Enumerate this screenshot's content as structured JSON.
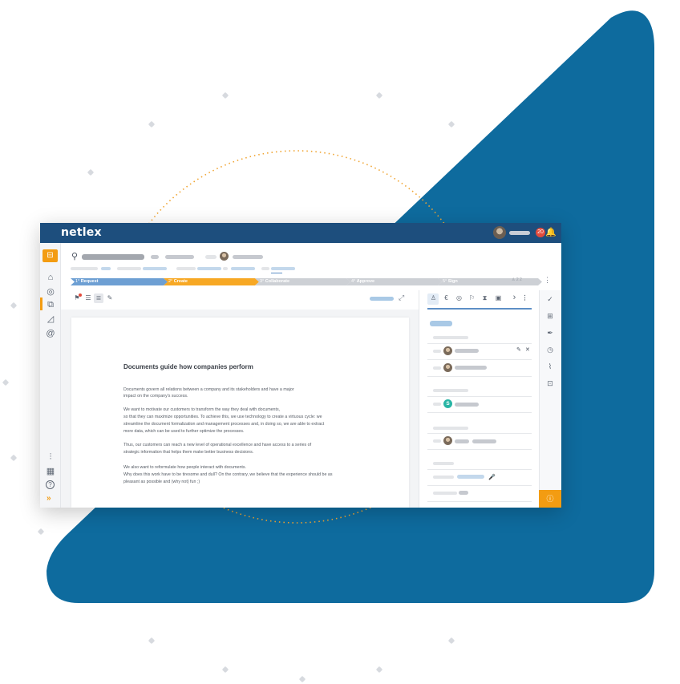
{
  "app": {
    "logo": "netlex",
    "notification_count": "20"
  },
  "icons": {
    "app_switch": "⊟",
    "home": "⌂",
    "chat": "◎",
    "documents": "⧉",
    "signature": "◿",
    "at": "@",
    "filters": "⫶",
    "calendar": "▦",
    "help": "?",
    "expand": "»",
    "bell": "🔔",
    "stamp": "⚲",
    "more": "⋮",
    "fullscreen": "⤢",
    "tb_list": "☰",
    "tb_text": "≣",
    "tb_edit": "✎",
    "tb_flag": "⚑",
    "tab_user": "♙",
    "tab_euro": "€",
    "tab_target": "◎",
    "tab_flag": "⚐",
    "tab_timer": "⧗",
    "tab_camera": "▣",
    "tab_next": "›",
    "tab_more": "⋮",
    "pencil": "✎",
    "close": "✕",
    "mic": "🎤",
    "check": "✓",
    "search_list": "⊞",
    "pen": "✒",
    "history": "◷",
    "clip": "⌇",
    "comments": "⊡",
    "info": "ⓘ"
  },
  "workflow": {
    "steps": [
      {
        "num": "1°",
        "label": "Request",
        "color": "#6d9fd3"
      },
      {
        "num": "2°",
        "label": "Create",
        "color": "#f7a824"
      },
      {
        "num": "3°",
        "label": "Collaborate",
        "color": "#cdd0d5"
      },
      {
        "num": "4°",
        "label": "Approve",
        "color": "#cdd0d5"
      },
      {
        "num": "5°",
        "label": "Sign",
        "color": "#cdd0d5"
      }
    ],
    "meta": "♙ 2 2"
  },
  "document": {
    "title": "Documents guide how companies perform",
    "lines": [
      "Documents govern all relations between a company and its stakeholders and have a major",
      "impact on the company's success.",
      "",
      "We want to motivate our customers to transform the way they deal with documents,",
      "so that they can maximize opportunities. To achieve this, we use technology to create a virtuous cycle: we",
      "streamline the document formalization and management processes and, in doing so, we are able to extract",
      "more data, which can be used to further optimize the processes.",
      "",
      "Thus, our customers can reach a new level of operational excellence and have access to a series of",
      "strategic information that helps them make better business decisions.",
      "",
      "We also want to reformulate how people interact with documents.",
      "Why does this work have to be tiresome and dull? On the contrary, we believe that the experience should be as",
      "pleasant as possible and (why not) fun ;)"
    ]
  },
  "rpanel": {
    "initial": "S"
  },
  "colors": {
    "topbar": "#1d4e7d",
    "accent": "#f39c12",
    "triangle": "#0e6b9e",
    "dots": "#f0a431"
  }
}
